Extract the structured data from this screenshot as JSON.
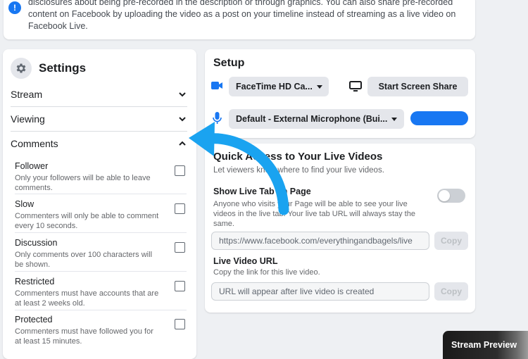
{
  "notice": {
    "icon": "info-icon",
    "text": "disclosures about being pre-recorded in the description or through graphics. You can also share pre-recorded content on Facebook by uploading the video as a post on your timeline instead of streaming as a live video on Facebook Live."
  },
  "settings": {
    "title": "Settings",
    "sections": [
      {
        "label": "Stream",
        "state": "collapsed"
      },
      {
        "label": "Viewing",
        "state": "collapsed"
      },
      {
        "label": "Comments",
        "state": "expanded"
      }
    ],
    "comment_options": [
      {
        "name": "Follower",
        "desc": "Only your followers will be able to leave comments.",
        "checked": false
      },
      {
        "name": "Slow",
        "desc": "Commenters will only be able to comment every 10 seconds.",
        "checked": false
      },
      {
        "name": "Discussion",
        "desc": "Only comments over 100 characters will be shown.",
        "checked": false
      },
      {
        "name": "Restricted",
        "desc": "Commenters must have accounts that are at least 2 weeks old.",
        "checked": false
      },
      {
        "name": "Protected",
        "desc": "Commenters must have followed you for at least 15 minutes.",
        "checked": false
      }
    ]
  },
  "setup": {
    "title": "Setup",
    "camera_select": "FaceTime HD Ca...",
    "screen_share_label": "Start Screen Share",
    "mic_select": "Default - External Microphone (Bui..."
  },
  "quick_access": {
    "title": "Quick Access to Your Live Videos",
    "subtitle": "Let viewers know where to find your live videos.",
    "live_tab_label": "Show Live Tab on Page",
    "live_tab_desc": "Anyone who visits your Page will be able to see your live videos in the live tab. Your live tab URL will always stay the same.",
    "live_tab_enabled": false,
    "live_tab_url": "https://www.facebook.com/everythingandbagels/live",
    "copy_label": "Copy",
    "video_url_label": "Live Video URL",
    "video_url_desc": "Copy the link for this live video.",
    "video_url_placeholder": "URL will appear after live video is created"
  },
  "stream_preview": {
    "label": "Stream Preview"
  },
  "colors": {
    "accent": "#1877f2",
    "arrow": "#1aa3f0"
  }
}
